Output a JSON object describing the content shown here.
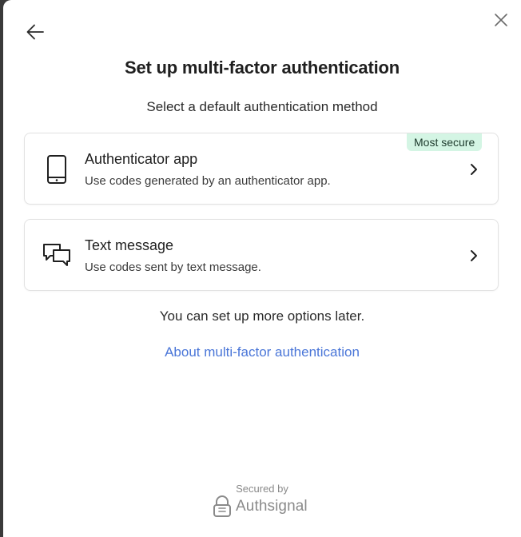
{
  "header": {
    "title": "Set up multi-factor authentication",
    "subtitle": "Select a default authentication method"
  },
  "options": [
    {
      "label": "Authenticator app",
      "description": "Use codes generated by an authenticator app.",
      "badge": "Most secure",
      "icon": "smartphone-icon"
    },
    {
      "label": "Text message",
      "description": "Use codes sent by text message.",
      "icon": "chat-bubbles-icon"
    }
  ],
  "footer_note": "You can set up more options later.",
  "about_link": "About multi-factor authentication",
  "branding": {
    "secured_by": "Secured by",
    "name": "Authsignal"
  },
  "colors": {
    "badge_bg": "#d4f5e4",
    "link": "#4a76d8",
    "backdrop": "#3a3a3a"
  }
}
